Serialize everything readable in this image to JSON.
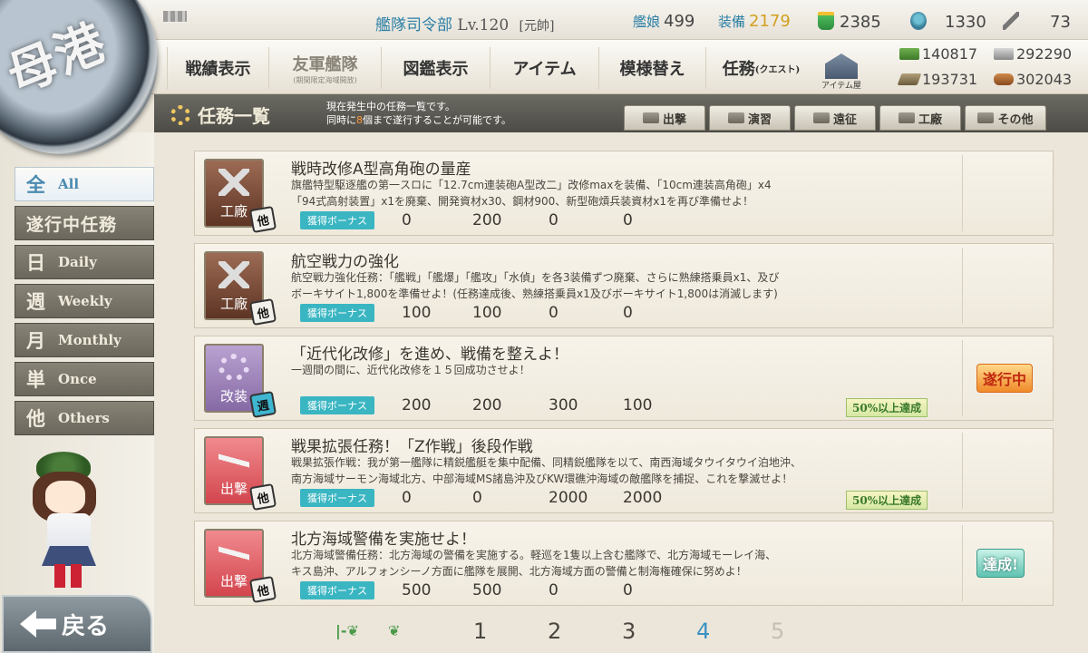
{
  "header": {
    "player_name": "",
    "hq_label": "艦隊司令部",
    "level": "Lv.120",
    "rank": "[元帥]",
    "ships_label": "艦娘",
    "ships": "499",
    "equip_label": "装備",
    "equip": "2179",
    "buckets": "2385",
    "torches": "1330",
    "dev_mats": "73"
  },
  "nav": {
    "battle_record": "戦績表示",
    "friend_fleet": "友軍艦隊",
    "friend_fleet_sub": "(期間限定海域開放)",
    "encyclopedia": "図鑑表示",
    "items": "アイテム",
    "remodel": "模様替え",
    "quest": "任務",
    "quest_sub": "(クエスト)",
    "item_shop": "アイテム屋"
  },
  "resources": {
    "fuel": "140817",
    "steel": "292290",
    "ammo": "193731",
    "bauxite": "302043"
  },
  "emblem_text": "母港",
  "section": {
    "title": "任務一覧",
    "desc_line1": "現在発生中の任務一覧です。",
    "desc_line2_pre": "同時に",
    "desc_line2_num": "8",
    "desc_line2_post": "個まで遂行することが可能です。",
    "tabs": [
      "出撃",
      "演習",
      "遠征",
      "工廠",
      "その他"
    ]
  },
  "filters": [
    {
      "k": "全",
      "e": "All"
    },
    {
      "k": "遂行中任務",
      "e": ""
    },
    {
      "k": "日",
      "e": "Daily"
    },
    {
      "k": "週",
      "e": "Weekly"
    },
    {
      "k": "月",
      "e": "Monthly"
    },
    {
      "k": "単",
      "e": "Once"
    },
    {
      "k": "他",
      "e": "Others"
    }
  ],
  "back_label": "戻る",
  "bonus_label": "獲得ボーナス",
  "quests": [
    {
      "icon_label": "工廠",
      "badge": "他",
      "title": "戦時改修A型高角砲の量産",
      "desc1": "旗艦特型駆逐艦の第一スロに「12.7cm連装砲A型改二」改修maxを装備、「10cm連装高角砲」x4",
      "desc2": "「94式高射装置」x1を廃棄、開発資材x30、鋼材900、新型砲熕兵装資材x1を再び準備せよ！",
      "fuel": "0",
      "ammo": "200",
      "steel": "0",
      "bauxite": "0",
      "progress": "",
      "status": ""
    },
    {
      "icon_label": "工廠",
      "badge": "他",
      "title": "航空戦力の強化",
      "desc1": "航空戦力強化任務：「艦戦」「艦爆」「艦攻」「水偵」を各3装備ずつ廃棄、さらに熟練搭乗員x1、及び",
      "desc2": "ボーキサイト1,800を準備せよ！(任務達成後、熟練搭乗員x1及びボーキサイト1,800は消滅します)",
      "fuel": "100",
      "ammo": "100",
      "steel": "0",
      "bauxite": "0",
      "progress": "",
      "status": ""
    },
    {
      "icon_label": "改装",
      "badge": "週",
      "title": "「近代化改修」を進め、戦備を整えよ！",
      "desc1": "一週間の間に、近代化改修を１５回成功させよ！",
      "desc2": "",
      "fuel": "200",
      "ammo": "200",
      "steel": "300",
      "bauxite": "100",
      "progress": "50%以上達成",
      "status": "遂行中"
    },
    {
      "icon_label": "出撃",
      "badge": "他",
      "title": "戦果拡張任務！「Z作戦」後段作戦",
      "desc1": "戦果拡張作戦：我が第一艦隊に精鋭艦艇を集中配備、同精鋭艦隊を以て、南西海域タウイタウイ泊地沖、",
      "desc2": "南方海域サーモン海域北方、中部海域MS諸島沖及びKW環礁沖海域の敵艦隊を捕捉、これを撃滅せよ！",
      "fuel": "0",
      "ammo": "0",
      "steel": "2000",
      "bauxite": "2000",
      "progress": "50%以上達成",
      "status": ""
    },
    {
      "icon_label": "出撃",
      "badge": "他",
      "title": "北方海域警備を実施せよ！",
      "desc1": "北方海域警備任務：北方海域の警備を実施する。軽巡を1隻以上含む艦隊で、北方海域モーレイ海、",
      "desc2": "キス島沖、アルフォンシーノ方面に艦隊を展開、北方海域方面の警備と制海権確保に努めよ！",
      "fuel": "500",
      "ammo": "500",
      "steel": "0",
      "bauxite": "0",
      "progress": "",
      "status": "達成!"
    }
  ],
  "pager": {
    "first": "|-❦",
    "prev": "❦",
    "pages": [
      "1",
      "2",
      "3",
      "4",
      "5"
    ]
  }
}
